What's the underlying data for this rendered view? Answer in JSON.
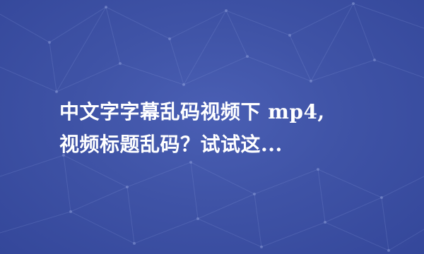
{
  "cover": {
    "title_line1": "中文字字幕乱码视频下 mp4,",
    "title_line2": "视频标题乱码？试试这...",
    "background_color": "#3f53a6",
    "text_color": "#ffffff"
  }
}
